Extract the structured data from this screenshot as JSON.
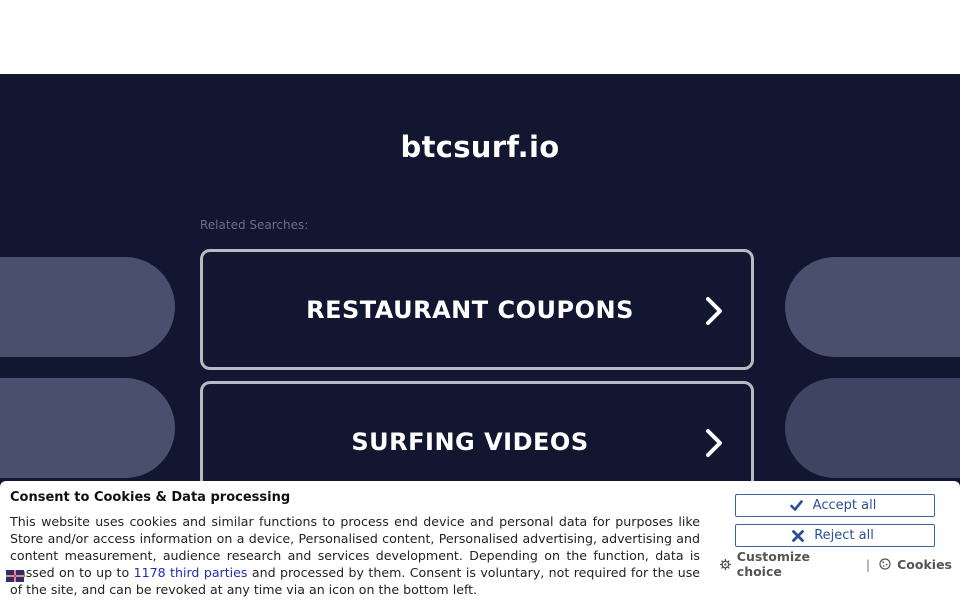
{
  "site": {
    "title": "btcsurf.io"
  },
  "related_label": "Related Searches:",
  "searches": [
    {
      "label": "RESTAURANT COUPONS"
    },
    {
      "label": "SURFING VIDEOS"
    }
  ],
  "consent": {
    "title": "Consent to Cookies & Data processing",
    "text_before_link": "This website uses cookies and similar functions to process end device and personal data for purposes like Store and/or access information on a device, Personalised content, Personalised advertising, advertising and content measurement, audience research and services development. Depending on the function, data is passed on to up to ",
    "link_text": "1178 third parties",
    "text_after_link": " and processed by them. Consent is voluntary, not required for the use of the site, and can be revoked at any time via an icon on the bottom left.",
    "accept_label": "Accept all",
    "reject_label": "Reject all",
    "customize_label": "Customize choice",
    "separator": "|",
    "cookies_label": "Cookies"
  },
  "colors": {
    "background": "#121630",
    "side_pill": "#4a4f6e",
    "button_border": "#b8b9c2",
    "consent_accent": "#2a4f9a",
    "link": "#1a2fb8"
  },
  "icons": {
    "search_arrow": "chevron-right-icon",
    "accept": "check-icon",
    "reject": "x-icon",
    "customize": "gear-icon",
    "cookies": "cookie-icon",
    "language": "flag-icon"
  }
}
